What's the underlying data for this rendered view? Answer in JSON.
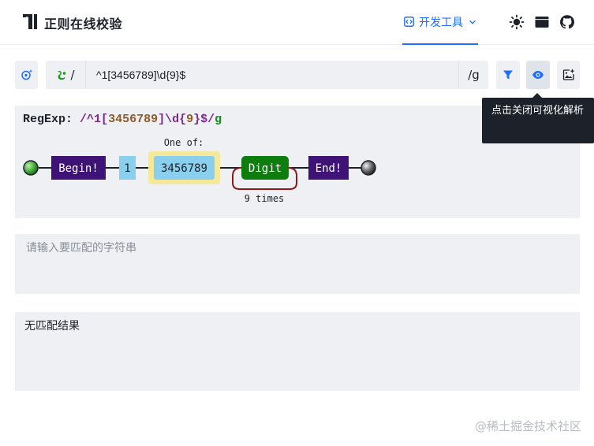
{
  "header": {
    "app_title": "正则在线校验",
    "devtools_label": "开发工具",
    "icons": [
      "logo-icon",
      "code-icon",
      "chevron-down-icon",
      "sun-icon",
      "window-icon",
      "github-icon"
    ]
  },
  "toolbar": {
    "regex_prefix": "/",
    "regex_value": "^1[3456789]\\d{9}$",
    "regex_suffix": "/g",
    "icons": [
      "ai-sparkle-icon",
      "regex-type-icon",
      "filter-icon",
      "eye-icon",
      "image-export-icon"
    ],
    "accent_color": "#1e6fff"
  },
  "tooltip": {
    "text": "点击关闭可视化解析"
  },
  "diagram": {
    "label_key": "RegExp:",
    "label_slash_open": "/",
    "label_part1": "^1[",
    "label_part2": "3456789",
    "label_part3": "]\\d{",
    "label_part4": "9",
    "label_part5": "}$",
    "label_slash_close": "/",
    "label_flag": "g",
    "one_of_label": "One of:",
    "begin": "Begin!",
    "literal": "1",
    "charset": "3456789",
    "digit": "Digit",
    "times": "9 times",
    "end": "End!",
    "colors": {
      "anchor": "#3e1276",
      "literal": "#8ad0ee",
      "charset_group": "#f4e99a",
      "digit": "#0d7d0d",
      "loop": "#8b1a1a"
    }
  },
  "input": {
    "placeholder": "请输入要匹配的字符串",
    "value": ""
  },
  "result": {
    "text": "无匹配结果"
  },
  "watermark": "@稀土掘金技术社区"
}
